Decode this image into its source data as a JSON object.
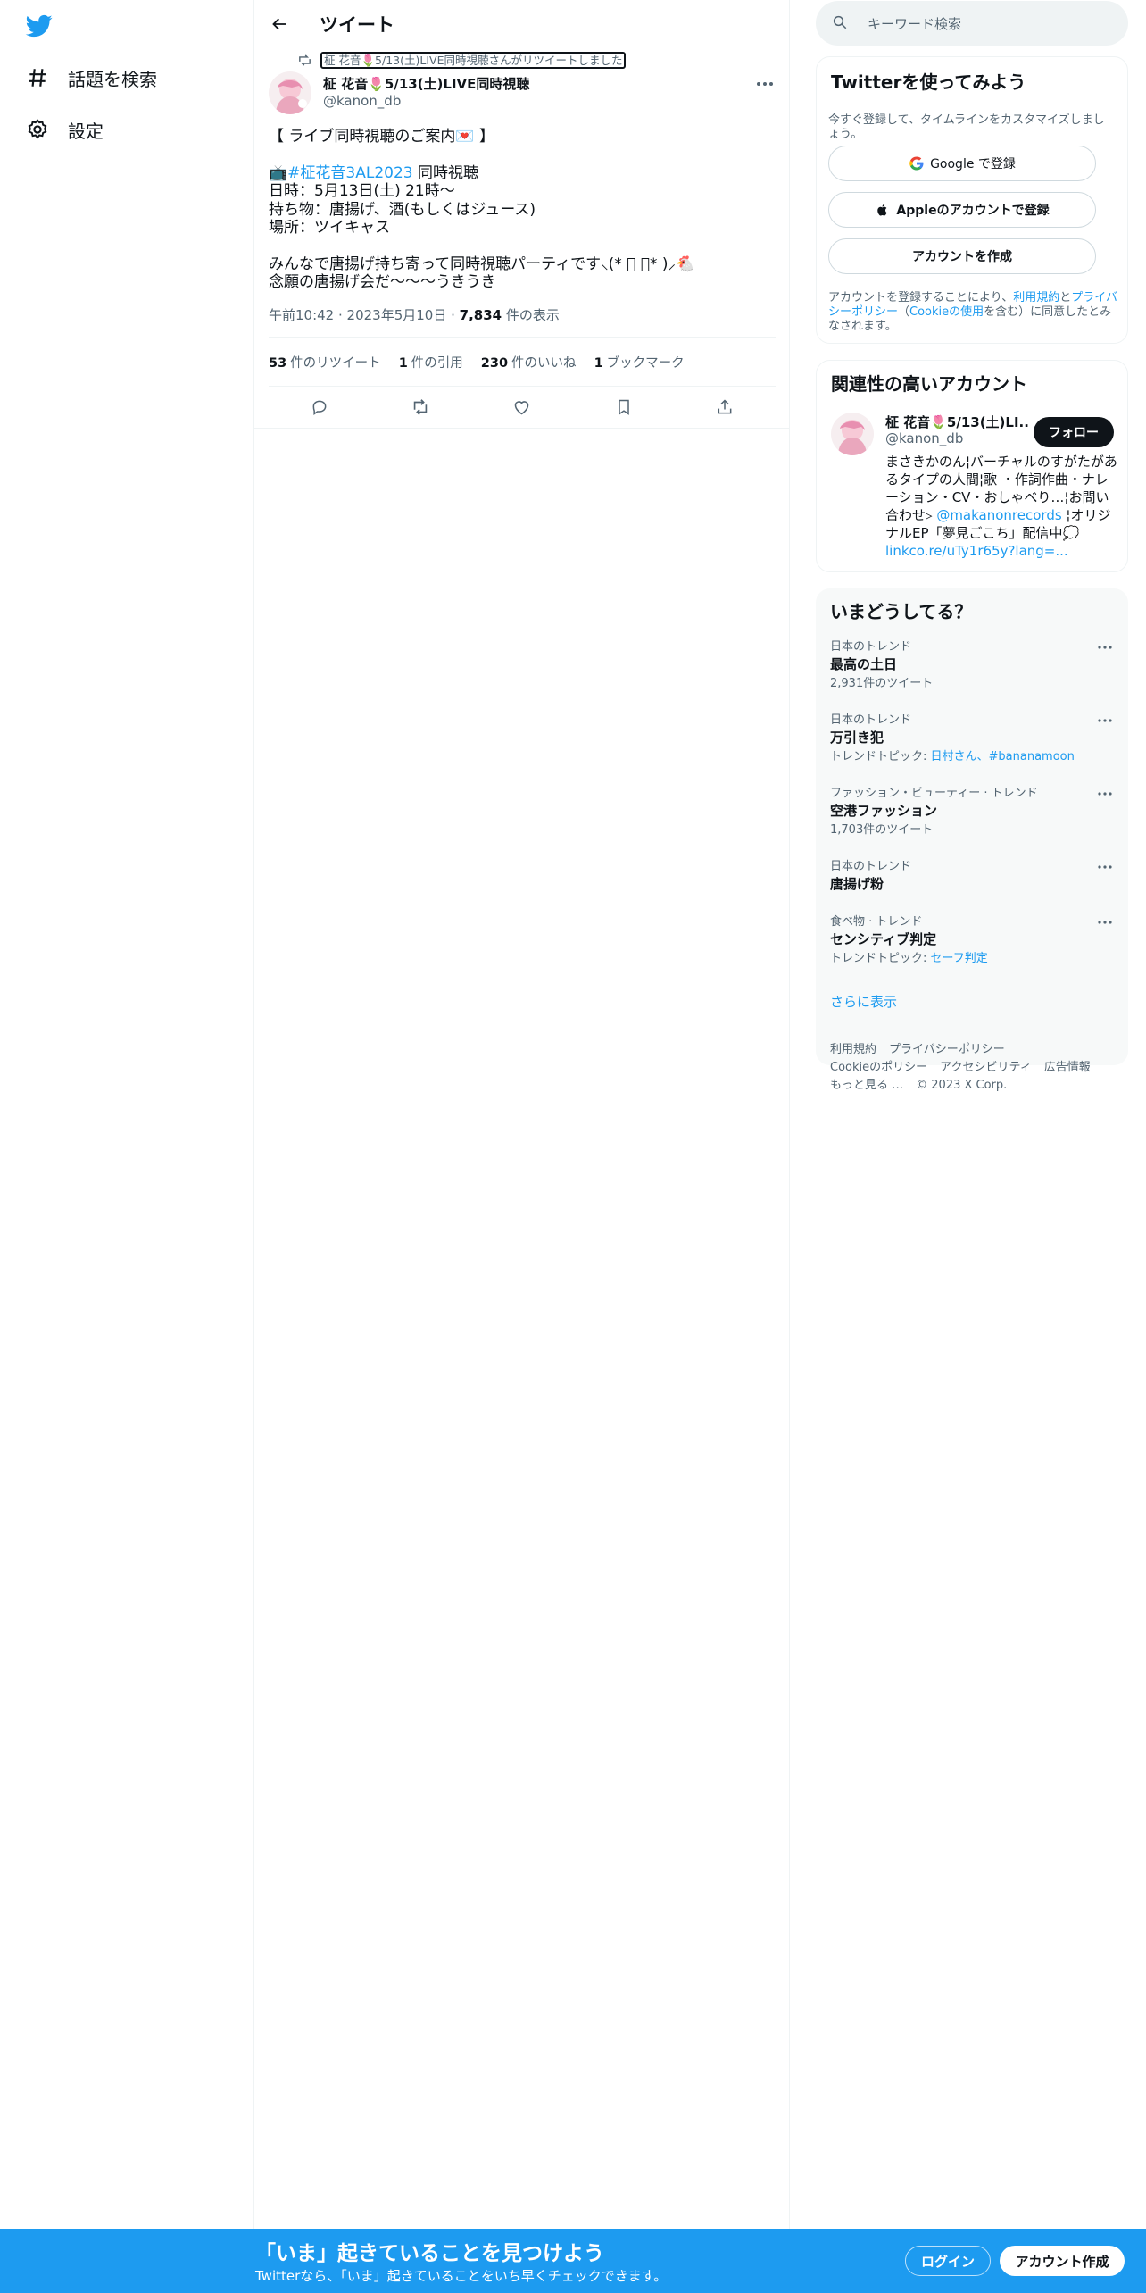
{
  "nav": {
    "items": [
      {
        "label": "話題を検索",
        "icon": "hashtag-icon"
      },
      {
        "label": "設定",
        "icon": "gear-icon"
      }
    ]
  },
  "header": {
    "title": "ツイート"
  },
  "tweet": {
    "retweeted_by": "柾 花音🌷5/13(土)LIVE同時視聴さんがリツイートしました",
    "author_name": "柾 花音🌷5/13(土)LIVE同時視聴",
    "author_handle": "@kanon_db",
    "lines": {
      "l1": "【 ライブ同時視聴のご案内💌 】",
      "l2_icon": "📺",
      "l2_tag": "#柾花音3AL2023",
      "l2_rest": " 同時視聴",
      "l3": "日時：5月13日(土) 21時〜",
      "l4": "持ち物：唐揚げ、酒(もしくはジュース)",
      "l5": "場所：ツイキャス",
      "l6": "みんなで唐揚げ持ち寄って同時視聴パーティです‪⸜(* ॑ ॑* )⸝🐔",
      "l7": "念願の唐揚げ会だ〜〜〜うきうき"
    },
    "meta": {
      "time": "午前10:42",
      "date": "2023年5月10日",
      "views_num": "7,834",
      "views_label": " 件の表示"
    },
    "stats": [
      {
        "num": "53",
        "label": "件のリツイート"
      },
      {
        "num": "1",
        "label": "件の引用"
      },
      {
        "num": "230",
        "label": "件のいいね"
      },
      {
        "num": "1",
        "label": "ブックマーク"
      }
    ]
  },
  "search": {
    "placeholder": "キーワード検索"
  },
  "signup_card": {
    "title": "Twitterを使ってみよう",
    "subtitle": "今すぐ登録して、タイムラインをカスタマイズしましょう。",
    "google": "Google で登録",
    "apple": "Appleのアカウントで登録",
    "create": "アカウントを作成",
    "legal_1": "アカウントを登録することにより、",
    "legal_terms": "利用規約",
    "legal_2": "と",
    "legal_privacy": "プライバシーポリシー",
    "legal_3": "（",
    "legal_cookie": "Cookieの使用",
    "legal_4": "を含む）に同意したとみなされます。"
  },
  "relevant": {
    "title": "関連性の高いアカウント",
    "name": "柾 花音🌷5/13(土)LI...",
    "handle": "@kanon_db",
    "follow": "フォロー",
    "bio_1": "まさきかのん¦バーチャルのすがたがあるタイプの人間¦歌 ・作詞作曲・ナレーション・CV・おしゃべり…¦お問い合わせ▹ ",
    "bio_link": "@makanonrecords",
    "bio_2": " ¦オリジナルEP「夢見ごこち」配信中💭 ",
    "bio_url": "linkco.re/uTy1r65y?lang=..."
  },
  "trends": {
    "title": "いまどうしてる？",
    "items": [
      {
        "category": "日本のトレンド",
        "name": "最高の土日",
        "sub": "2,931件のツイート"
      },
      {
        "category": "日本のトレンド",
        "name": "万引き犯",
        "sub_label": "トレンドトピック: ",
        "sub_links": "日村さん、#bananamoon"
      },
      {
        "category": "ファッション・ビューティー · トレンド",
        "name": "空港ファッション",
        "sub": "1,703件のツイート"
      },
      {
        "category": "日本のトレンド",
        "name": "唐揚げ粉"
      },
      {
        "category": "食べ物 · トレンド",
        "name": "センシティブ判定",
        "sub_label": "トレンドトピック: ",
        "sub_links": "セーフ判定"
      }
    ],
    "show_more": "さらに表示"
  },
  "footer": {
    "links": [
      "利用規約",
      "プライバシーポリシー",
      "Cookieのポリシー",
      "アクセシビリティ",
      "広告情報",
      "もっと見る …",
      "© 2023 X Corp."
    ]
  },
  "bottom_bar": {
    "title": "「いま」起きていることを見つけよう",
    "subtitle": "Twitterなら、「いま」起きていることをいち早くチェックできます。",
    "login": "ログイン",
    "signup": "アカウント作成"
  },
  "colors": {
    "accent": "#1d9bf0",
    "text": "#0f1419",
    "muted": "#536471"
  }
}
